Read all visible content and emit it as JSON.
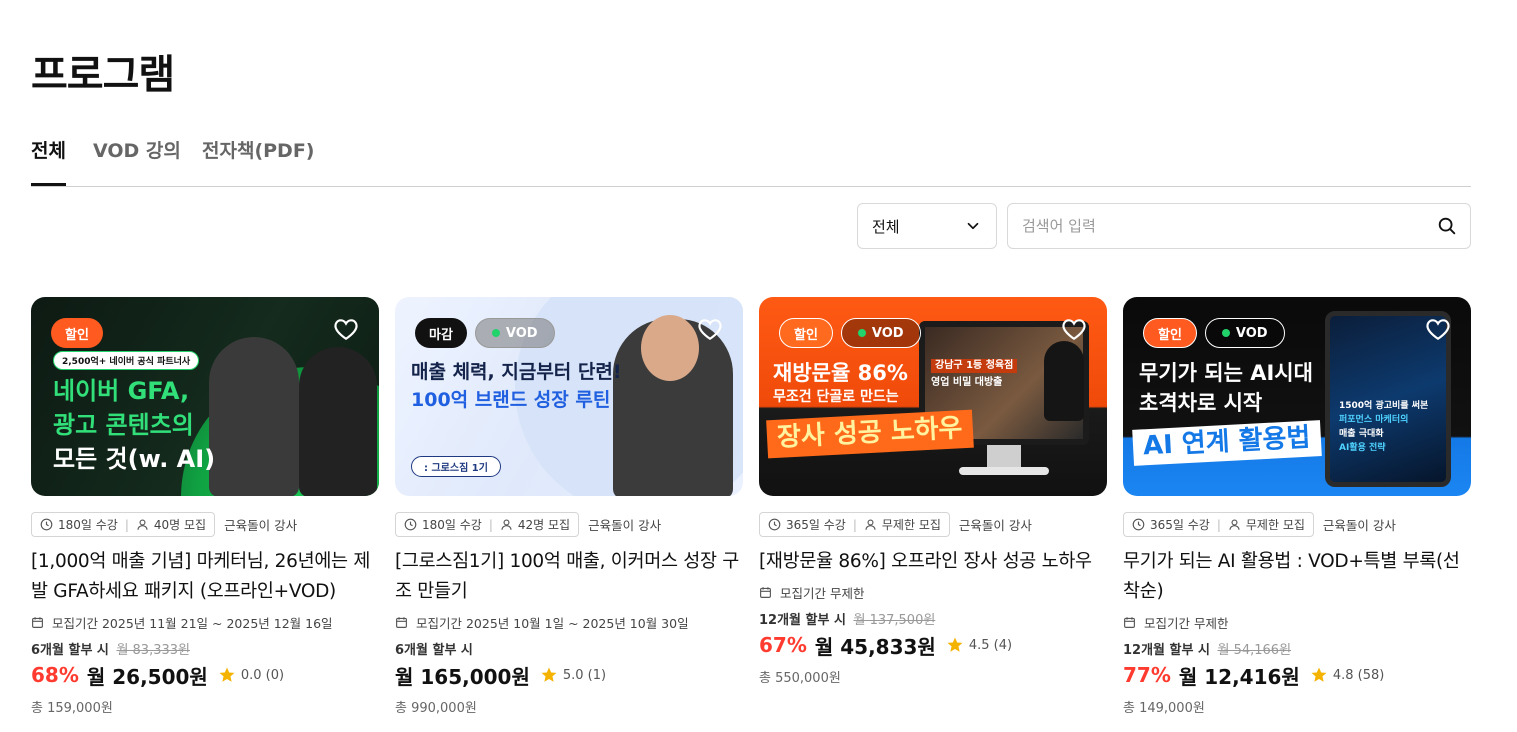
{
  "page": {
    "title": "프로그램"
  },
  "tabs": [
    {
      "label": "전체",
      "active": true
    },
    {
      "label": "VOD 강의",
      "active": false
    },
    {
      "label": "전자책(PDF)",
      "active": false
    }
  ],
  "filter": {
    "selected": "전체"
  },
  "search": {
    "placeholder": "검색어 입력",
    "value": ""
  },
  "colors": {
    "sale_badge": "#ff5a1f",
    "discount": "#ff3b30",
    "star": "#f5b301",
    "vod_dot": "#22d36b"
  },
  "cards": [
    {
      "badges": [
        "할인"
      ],
      "thumb_lines": [
        "2,500억+ 네이버 공식 파트너사",
        "네이버 GFA,",
        "광고 콘텐츠의",
        "모든 것(w. AI)"
      ],
      "duration": "180일 수강",
      "capacity": "40명 모집",
      "instructor": "근육돌이 강사",
      "title": "[1,000억 매출 기념] 마케터님, 26년에는 제발 GFA하세요 패키지 (오프라인+VOD)",
      "period": "모집기간 2025년 11월 21일 ~ 2025년 12월 16일",
      "installment": "6개월 할부 시",
      "original_monthly": "월 83,333원",
      "discount": "68%",
      "price": "월 26,500원",
      "rating": "0.0 (0)",
      "total": "총 159,000원"
    },
    {
      "badges": [
        "마감",
        "VOD"
      ],
      "thumb_lines": [
        "매출 체력, 지금부터 단련!",
        "100억 브랜드 성장 루틴",
        ": 그로스짐 1기"
      ],
      "duration": "180일 수강",
      "capacity": "42명 모집",
      "instructor": "근육돌이 강사",
      "title": "[그로스짐1기] 100억 매출, 이커머스 성장 구조 만들기",
      "period": "모집기간 2025년 10월 1일 ~ 2025년 10월 30일",
      "installment": "6개월 할부 시",
      "original_monthly": "",
      "discount": "",
      "price": "월 165,000원",
      "rating": "5.0 (1)",
      "total": "총 990,000원"
    },
    {
      "badges": [
        "할인",
        "VOD"
      ],
      "thumb_lines": [
        "재방문율 86%",
        "무조건 단골로 만드는",
        "장사 성공 노하우",
        "강남구 1등 청육점",
        "영업 비밀 대방출"
      ],
      "duration": "365일 수강",
      "capacity": "무제한 모집",
      "instructor": "근육돌이 강사",
      "title": "[재방문율 86%] 오프라인 장사 성공 노하우",
      "period": "모집기간 무제한",
      "installment": "12개월 할부 시",
      "original_monthly": "월 137,500원",
      "discount": "67%",
      "price": "월 45,833원",
      "rating": "4.5 (4)",
      "total": "총 550,000원"
    },
    {
      "badges": [
        "할인",
        "VOD"
      ],
      "thumb_lines": [
        "무기가 되는 AI시대",
        "초격차로 시작",
        "AI 연계 활용법",
        "1500억 광고비를 써본",
        "퍼포먼스 마케터의",
        "매출 극대화",
        "AI활용 전략"
      ],
      "duration": "365일 수강",
      "capacity": "무제한 모집",
      "instructor": "근육돌이 강사",
      "title": "무기가 되는 AI 활용법 : VOD+특별 부록(선착순)",
      "period": "모집기간 무제한",
      "installment": "12개월 할부 시",
      "original_monthly": "월 54,166원",
      "discount": "77%",
      "price": "월 12,416원",
      "rating": "4.8 (58)",
      "total": "총 149,000원"
    }
  ]
}
